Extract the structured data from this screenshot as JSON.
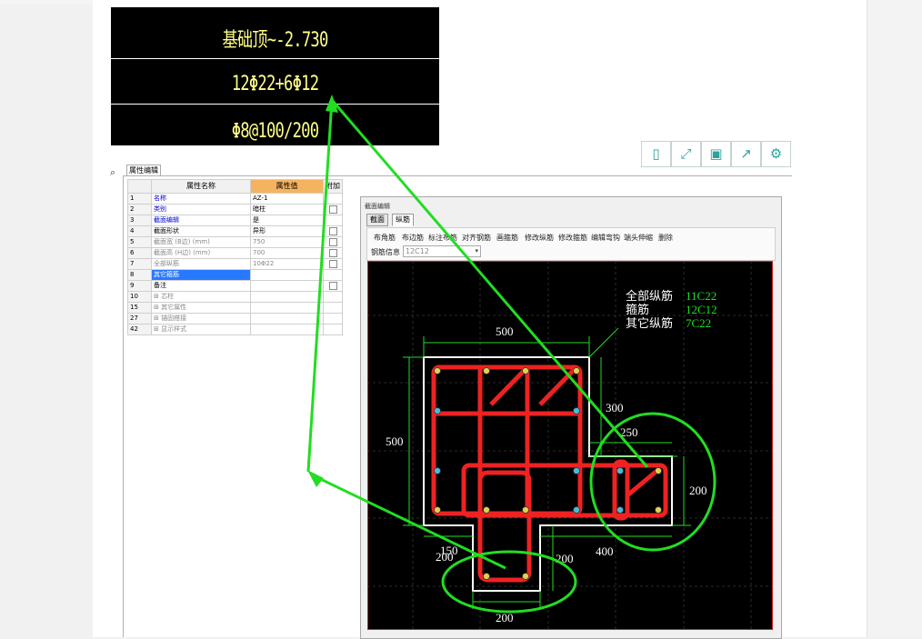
{
  "zoom_panel": {
    "line1": "基础顶~-2.730",
    "line2": "12Φ22+6Φ12",
    "line3": "Φ8@100/200"
  },
  "toolbar_icons": [
    "tablet-icon",
    "fullscreen-icon",
    "save-icon",
    "share-icon",
    "settings-icon"
  ],
  "property_panel": {
    "tab_label": "属性编辑",
    "headers": {
      "name": "属性名称",
      "value": "属性值",
      "extra": "附加"
    },
    "rows": [
      {
        "no": "1",
        "name": "名称",
        "value": "AZ-1"
      },
      {
        "no": "2",
        "name": "类别",
        "value": "暗柱"
      },
      {
        "no": "3",
        "name": "截面编辑",
        "value": "是"
      },
      {
        "no": "4",
        "name": "截面形状",
        "value": "异形"
      },
      {
        "no": "5",
        "name": "截面宽 (B边) (mm)",
        "value": "750"
      },
      {
        "no": "6",
        "name": "截面高 (H边) (mm)",
        "value": "700"
      },
      {
        "no": "7",
        "name": "全部纵筋",
        "value": "10Φ22"
      },
      {
        "no": "8",
        "name": "其它箍筋",
        "value": ""
      },
      {
        "no": "9",
        "name": "备注",
        "value": ""
      },
      {
        "no": "10",
        "name": "芯柱",
        "value": ""
      },
      {
        "no": "15",
        "name": "其它属性",
        "value": ""
      },
      {
        "no": "27",
        "name": "锚固搭接",
        "value": ""
      },
      {
        "no": "42",
        "name": "显示样式",
        "value": ""
      }
    ]
  },
  "section_editor": {
    "title": "截面编辑",
    "tabs": [
      "截面",
      "纵筋"
    ],
    "toolbar": [
      "布角筋",
      "布边筋",
      "标注布筋",
      "对齐钢筋",
      "画箍筋",
      "修改纵筋",
      "修改箍筋",
      "编辑弯钩",
      "端头伸缩",
      "删除"
    ],
    "rebar_label": "钢筋信息",
    "rebar_value": "12C12"
  },
  "drawing": {
    "legend": [
      {
        "label": "全部纵筋",
        "value": "11C22"
      },
      {
        "label": "箍筋",
        "value": "12C12"
      },
      {
        "label": "其它纵筋",
        "value": "7C22"
      }
    ],
    "dims": {
      "top": "500",
      "left": "500",
      "notch_h": "300",
      "right_w": "250",
      "right_h": "200",
      "bottom_left": "200",
      "bottom_150": "150",
      "bottom_200b": "200",
      "bottom_400": "400",
      "bottom": "200"
    }
  },
  "colors": {
    "annotation_green": "#22dd22",
    "rebar_red": "#ee2222",
    "dim_yellow": "#ffff88"
  }
}
